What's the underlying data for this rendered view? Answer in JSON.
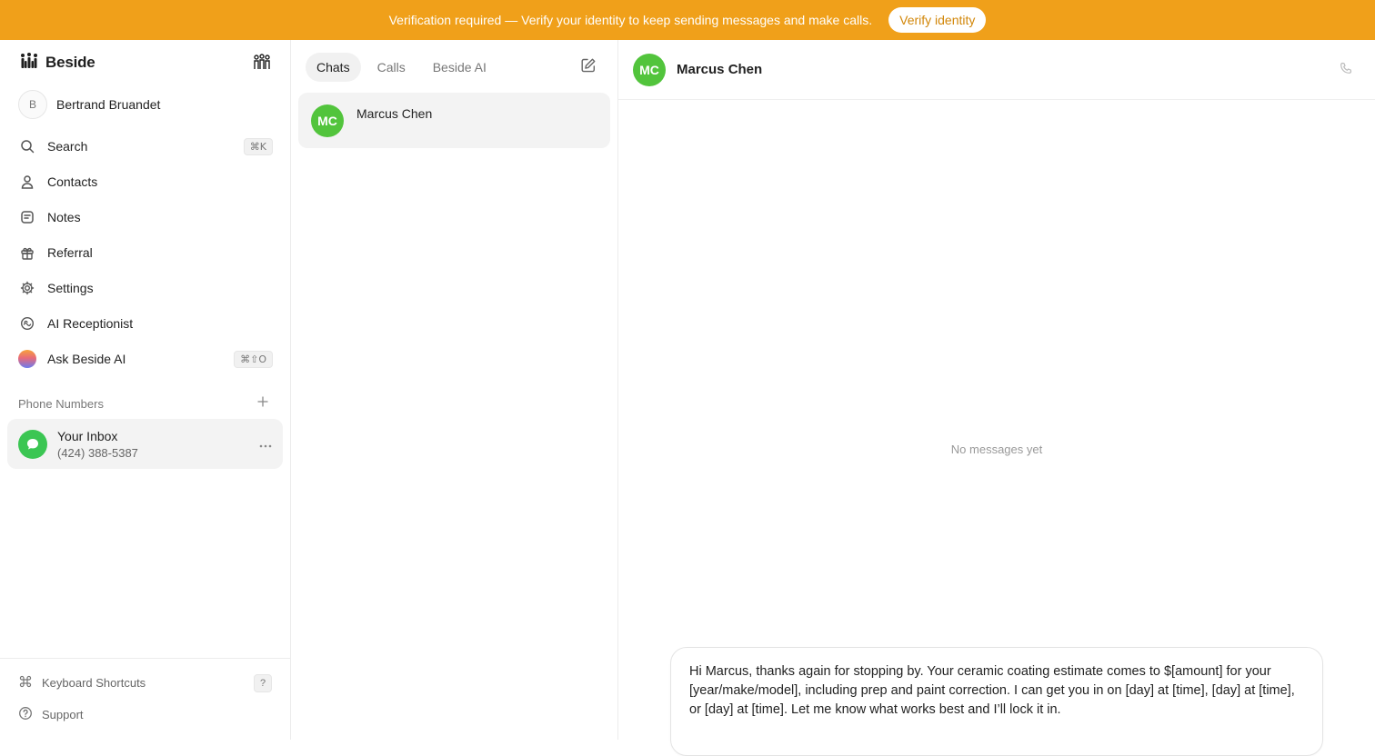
{
  "banner": {
    "message": "Verification required — Verify your identity to keep sending messages and make calls.",
    "button_label": "Verify identity"
  },
  "sidebar": {
    "brand": "Beside",
    "user": {
      "initial": "B",
      "name": "Bertrand Bruandet"
    },
    "items": [
      {
        "label": "Search",
        "icon": "search-icon",
        "shortcut": "⌘K"
      },
      {
        "label": "Contacts",
        "icon": "person-icon"
      },
      {
        "label": "Notes",
        "icon": "note-icon"
      },
      {
        "label": "Referral",
        "icon": "gift-icon"
      },
      {
        "label": "Settings",
        "icon": "gear-icon"
      },
      {
        "label": "AI Receptionist",
        "icon": "ai-receptionist-icon"
      },
      {
        "label": "Ask Beside AI",
        "icon": "beside-ai-orb-icon",
        "shortcut": "⌘⇧O"
      }
    ],
    "phone_numbers_label": "Phone Numbers",
    "inbox": {
      "title": "Your Inbox",
      "phone": "(424) 388-5387"
    },
    "footer": {
      "shortcuts_label": "Keyboard Shortcuts",
      "shortcuts_key": "?",
      "support_label": "Support"
    }
  },
  "list": {
    "tabs": [
      {
        "label": "Chats",
        "active": true
      },
      {
        "label": "Calls",
        "active": false
      },
      {
        "label": "Beside AI",
        "active": false
      }
    ],
    "chats": [
      {
        "initials": "MC",
        "name": "Marcus Chen"
      }
    ]
  },
  "conversation": {
    "initials": "MC",
    "name": "Marcus Chen",
    "empty_text": "No messages yet",
    "draft": "Hi Marcus, thanks again for stopping by. Your ceramic coating estimate comes to $[amount] for your [year/make/model], including prep and paint correction. I can get you in on [day] at [time], [day] at [time], or [day] at [time]. Let me know what works best and I’ll lock it in."
  },
  "colors": {
    "banner": "#f0a01a",
    "avatar_green": "#52c43c",
    "inbox_green": "#3bc653"
  }
}
